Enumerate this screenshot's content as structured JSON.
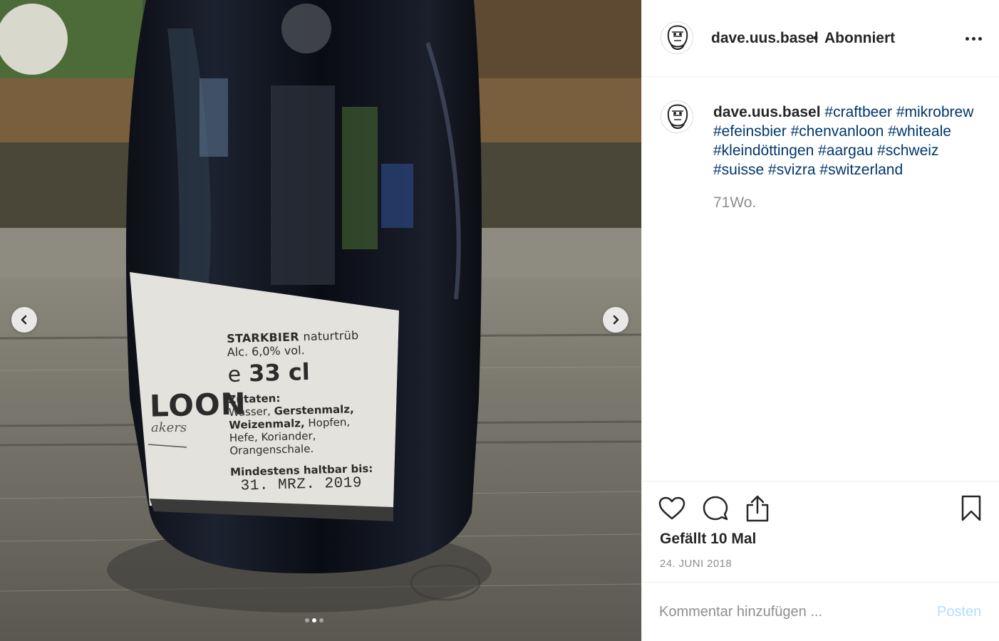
{
  "post": {
    "username": "dave.uus.basel",
    "separator": "•",
    "follow_status": "Abonniert",
    "caption_tags": [
      "#craftbeer",
      "#mikrobrew",
      "#efeinsbier",
      "#chenvanloon",
      "#whiteale",
      "#kleindöttingen",
      "#aargau",
      "#schweiz",
      "#suisse",
      "#svizra",
      "#switzerland"
    ],
    "time_ago": "71Wo.",
    "likes": "Gefällt 10 Mal",
    "date": "24. JUNI 2018"
  },
  "carousel": {
    "total_images": 3,
    "active_index": 1
  },
  "bottle_label": {
    "brand_fragment": "LOON",
    "brand_sub": "akers",
    "line1_bold": "STARKBIER",
    "line1_rest": "naturtrüb",
    "alcohol": "Alc. 6,0% vol.",
    "volume_symbol": "e",
    "volume": "33 cl",
    "ingredients_heading": "Zutaten:",
    "ingredients": [
      {
        "text": "Wasser, ",
        "bold": false
      },
      {
        "text": "Gerstenmalz,",
        "bold": true
      },
      {
        "text": "Weizenmalz,",
        "bold": true
      },
      {
        "text": " Hopfen,",
        "bold": false
      },
      {
        "text": "Hefe, Koriander,",
        "bold": false
      },
      {
        "text": "Orangenschale.",
        "bold": false
      }
    ],
    "best_before_label": "Mindestens haltbar bis:",
    "best_before_date": "31. MRZ. 2019"
  },
  "comment": {
    "placeholder": "Kommentar hinzufügen ...",
    "post_label": "Posten"
  },
  "colors": {
    "text": "#262626",
    "hashtag": "#00376b",
    "secondary": "#8e8e8e",
    "post_disabled": "#b2dffc",
    "border": "#efefef"
  },
  "icons": [
    "chevron-left-icon",
    "chevron-right-icon",
    "more-icon",
    "heart-icon",
    "comment-icon",
    "share-icon",
    "bookmark-icon"
  ]
}
